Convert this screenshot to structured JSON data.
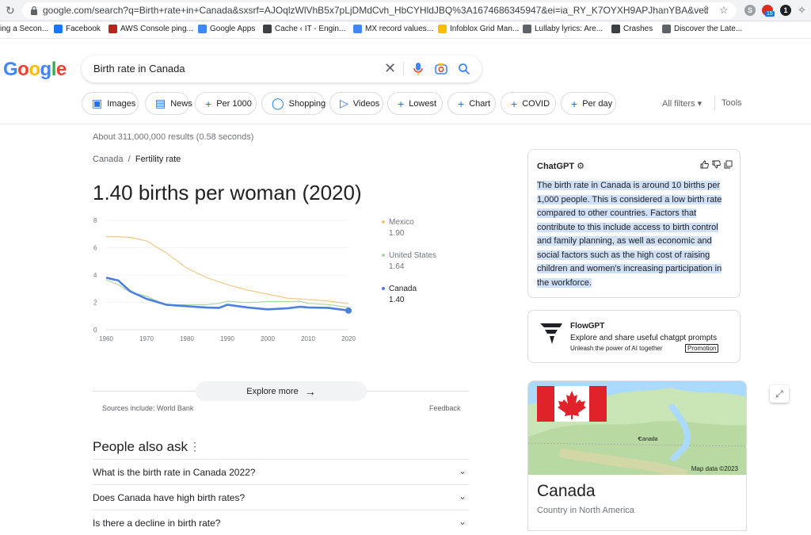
{
  "browser": {
    "url": "google.com/search?q=Birth+rate+in+Canada&sxsrf=AJOqlzWlVhB5x7pLjDMdCvh_HbCYHldJBQ%3A1674686345947&ei=ia_RY_K7OYXH9APJhanYBA&ved=0ahUKEwiyp...",
    "ext_badge": "15"
  },
  "bookmarks": [
    {
      "label": "ing a Secon...",
      "color": "#ffffff"
    },
    {
      "label": "Facebook",
      "color": "#1877f2"
    },
    {
      "label": "AWS Console ping...",
      "color": "#b3261e"
    },
    {
      "label": "Google Apps",
      "color": "#4285f4"
    },
    {
      "label": "Cache ‹ IT - Engin...",
      "color": "#3c4043"
    },
    {
      "label": "MX record values...",
      "color": "#4285f4"
    },
    {
      "label": "Infoblox Grid Man...",
      "color": "#fbbc04"
    },
    {
      "label": "Lullaby lyrics: Are...",
      "color": "#5f6368"
    },
    {
      "label": "Crashes",
      "color": "#3c4043"
    },
    {
      "label": "Discover the Late...",
      "color": "#5f6368"
    }
  ],
  "logo": "Google",
  "search": {
    "query": "Birth rate in Canada"
  },
  "chips": [
    "Images",
    "News",
    "Per 1000",
    "Shopping",
    "Videos",
    "Lowest",
    "Chart",
    "COVID",
    "Per day"
  ],
  "filters": {
    "all_filters": "All filters",
    "tools": "Tools"
  },
  "results": {
    "stats": "About 311,000,000 results (0.58 seconds)",
    "crumb_root": "Canada",
    "crumb_leaf": "Fertility rate",
    "headline": "1.40 births per woman (2020)",
    "explore_more": "Explore more",
    "sources": "Sources include: World Bank",
    "feedback": "Feedback"
  },
  "chart_data": {
    "type": "line",
    "x": [
      1960,
      1963,
      1966,
      1970,
      1975,
      1980,
      1985,
      1988,
      1990,
      1995,
      2000,
      2005,
      2008,
      2010,
      2015,
      2020
    ],
    "xticks": [
      "1960",
      "1970",
      "1980",
      "1990",
      "2000",
      "2010",
      "2020"
    ],
    "yticks": [
      "0",
      "2",
      "4",
      "6",
      "8"
    ],
    "ylim": [
      0,
      8
    ],
    "series": [
      {
        "name": "Mexico",
        "color": "#f3c37b",
        "value_label": "1.90",
        "values": [
          6.8,
          6.8,
          6.75,
          6.5,
          5.6,
          4.5,
          3.8,
          3.5,
          3.3,
          2.9,
          2.6,
          2.3,
          2.25,
          2.2,
          2.1,
          1.9
        ]
      },
      {
        "name": "United States",
        "color": "#a8d5a2",
        "value_label": "1.64",
        "values": [
          3.65,
          3.3,
          2.75,
          2.45,
          1.78,
          1.84,
          1.84,
          1.93,
          2.08,
          1.98,
          2.06,
          2.06,
          2.08,
          1.93,
          1.84,
          1.64
        ]
      },
      {
        "name": "Canada",
        "color": "#4c7fe0",
        "value_label": "1.40",
        "values": [
          3.81,
          3.6,
          2.8,
          2.26,
          1.82,
          1.72,
          1.62,
          1.6,
          1.83,
          1.63,
          1.49,
          1.57,
          1.68,
          1.63,
          1.6,
          1.4
        ]
      }
    ]
  },
  "paa": {
    "title": "People also ask",
    "items": [
      "What is the birth rate in Canada 2022?",
      "Does Canada have high birth rates?",
      "Is there a decline in birth rate?"
    ]
  },
  "chatgpt": {
    "title": "ChatGPT",
    "body": "The birth rate in Canada is around 10 births per 1,000 people. This is considered a low birth rate compared to other countries. Factors that contribute to this include access to birth control and family planning, as well as economic and social factors such as the high cost of raising children and women's increasing participation in the workforce."
  },
  "flowgpt": {
    "title": "FlowGPT",
    "desc": "Explore and share useful chatgpt prompts",
    "tagline": "Unleash the power of AI together",
    "promo": "Promotion"
  },
  "knowledge_panel": {
    "map_label": "Canada",
    "map_data": "Map data ©2023",
    "name": "Canada",
    "subtitle": "Country in North America"
  }
}
